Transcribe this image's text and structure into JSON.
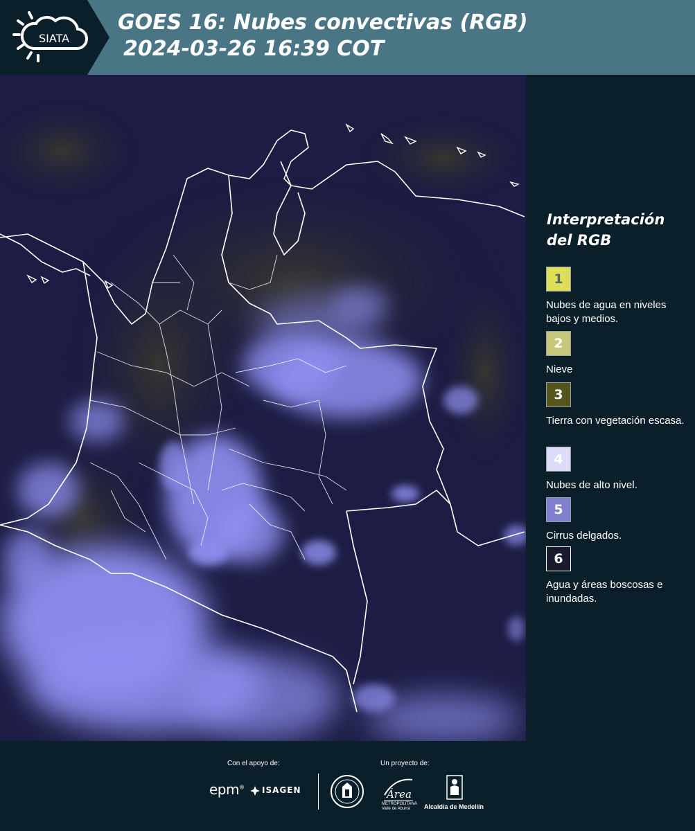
{
  "header": {
    "logo_text": "SIATA",
    "title_line1": "GOES 16: Nubes convectivas (RGB)",
    "title_line2": "2024-03-26 16:39 COT",
    "background_color": "#4a7584",
    "logo_color": "#0b1f2b"
  },
  "map": {
    "projection_region": "Colombia",
    "background_color": "#1a1a3e",
    "cloud_color": "#8f8ff0",
    "border_color": "#ffffff"
  },
  "legend": {
    "title": "Interpretación del RGB",
    "items": [
      {
        "number": "1",
        "label": "Nubes de agua en niveles bajos y medios.",
        "color": "#dede5a",
        "text_color": "#556655"
      },
      {
        "number": "2",
        "label": "Nieve",
        "color": "#c8c77c",
        "text_color": "#ffffff"
      },
      {
        "number": "3",
        "label": "Tierra con vegetación escasa.",
        "color": "#55561c",
        "text_color": "#ffffff"
      },
      {
        "number": "4",
        "label": "Nubes de alto nivel.",
        "color": "#dcdcf8",
        "text_color": "#ffffff"
      },
      {
        "number": "5",
        "label": "Cirrus delgados.",
        "color": "#7f7fd0",
        "text_color": "#ffffff"
      },
      {
        "number": "6",
        "label": "Agua y áreas boscosas e inundadas.",
        "color": "#1a1a2e",
        "text_color": "#ffffff"
      }
    ]
  },
  "footer": {
    "support_label": "Con el apoyo de:",
    "project_label": "Un proyecto de:",
    "epm_text": "epm",
    "isagen_text": "ISAGEN",
    "area_text": "Área",
    "area_subtext": "METROPOLITANA Valle de Aburrá",
    "medellin_text": "Alcaldía de Medellín",
    "seal_icon": "medellin-seal-icon",
    "background_color": "#0b1f2b"
  }
}
